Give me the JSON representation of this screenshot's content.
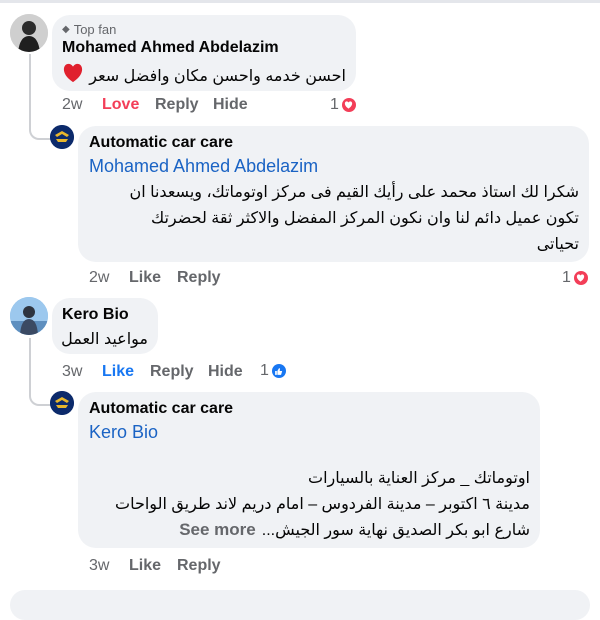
{
  "comments": [
    {
      "badge": "Top fan",
      "author": "Mohamed Ahmed Abdelazim",
      "text": "احسن خدمه واحسن مكان وافضل سعر",
      "time": "2w",
      "actions": [
        "Love",
        "Reply",
        "Hide"
      ],
      "reaction_count": "1",
      "reaction_type": "love"
    },
    {
      "author": "Automatic car care",
      "mention": "Mohamed Ahmed Abdelazim",
      "lines": [
        "شكرا لك استاذ محمد على رأيك القيم فى مركز اوتوماتك،  ويسعدنا ان",
        "تكون عميل دائم لنا وان نكون المركز المفضل والاكثر ثقة لحضرتك",
        "تحياتى"
      ],
      "time": "2w",
      "actions": [
        "Like",
        "Reply"
      ],
      "reaction_count": "1",
      "reaction_type": "love"
    },
    {
      "author": "Kero Bio",
      "text": "مواعيد العمل",
      "time": "3w",
      "actions": [
        "Like",
        "Reply",
        "Hide"
      ],
      "reaction_count": "1",
      "reaction_type": "like"
    },
    {
      "author": "Automatic car care",
      "mention": "Kero Bio",
      "lines": [
        "اوتوماتك _ مركز العناية بالسيارات",
        "مدينة ٦ اكتوبر – مدينة الفردوس –  امام دريم لاند طريق الواحات",
        "شارع ابو بكر الصديق نهاية سور الجيش..."
      ],
      "see_more": "See more",
      "time": "3w",
      "actions": [
        "Like",
        "Reply"
      ]
    }
  ],
  "icons": {
    "badge": "diamond-icon",
    "heart": "red-heart-emoji-icon",
    "love_reaction": "love-reaction-icon",
    "like_reaction": "like-reaction-icon"
  },
  "colors": {
    "bubble": "#f0f2f5",
    "mention": "#1a63c4",
    "love": "#f33e58",
    "like": "#1877f2",
    "muted": "#65676b"
  }
}
